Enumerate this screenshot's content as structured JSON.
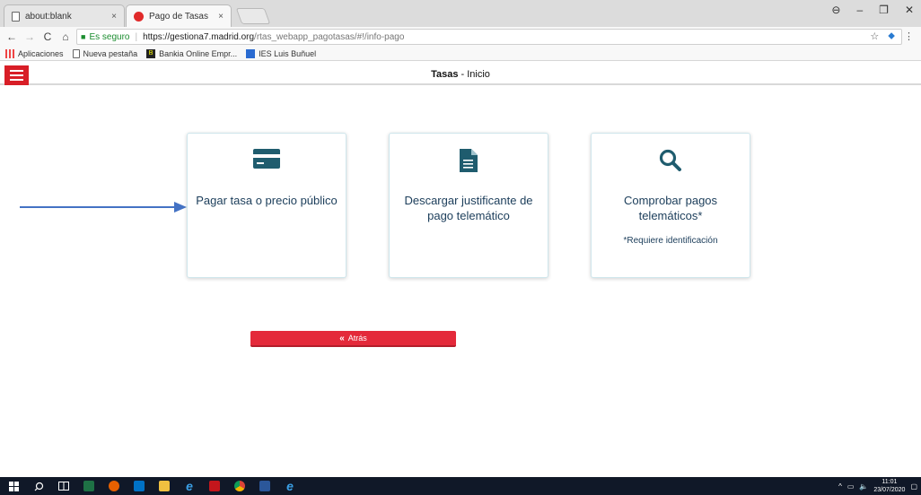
{
  "browser": {
    "tabs": [
      {
        "title": "about:blank",
        "active": false
      },
      {
        "title": "Pago de Tasas",
        "active": true
      }
    ],
    "tab_close": "×",
    "window_controls": {
      "account": "⊖",
      "minimize": "–",
      "maximize": "❐",
      "close": "✕"
    },
    "nav": {
      "back": "←",
      "forward": "→",
      "reload": "C",
      "home": "⌂"
    },
    "address": {
      "secure_label": "Es seguro",
      "url_host": "https://gestiona7.madrid.org",
      "url_path": "/rtas_webapp_pagotasas/#!/info-pago"
    },
    "addr_actions": {
      "star": "☆",
      "ext": "⬥",
      "menu": "⋮"
    },
    "bookmarks": [
      {
        "label": "Aplicaciones",
        "icon": "apps-icon"
      },
      {
        "label": "Nueva pestaña",
        "icon": "page-icon"
      },
      {
        "label": "Bankia Online Empr...",
        "icon": "bankia-icon"
      },
      {
        "label": "IES Luis Buñuel",
        "icon": "ies-icon"
      }
    ]
  },
  "app": {
    "title_bold": "Tasas",
    "title_rest": " - Inicio"
  },
  "cards": [
    {
      "label": "Pagar tasa o precio público",
      "icon": "credit-card-icon",
      "note": ""
    },
    {
      "label": "Descargar justificante de pago telemático",
      "icon": "document-icon",
      "note": ""
    },
    {
      "label": "Comprobar pagos telemáticos*",
      "icon": "search-icon",
      "note": "*Requiere identificación"
    }
  ],
  "back_button": {
    "chevron": "«",
    "label": "Atrás"
  },
  "taskbar": {
    "time": "11:01",
    "date": "23/07/2020",
    "tray_chevron": "^",
    "volume": "🔈"
  },
  "colors": {
    "brand_red": "#d81e27",
    "button_red": "#e4293a",
    "icon_teal": "#1f5c6e",
    "arrow_blue": "#4472c4"
  }
}
